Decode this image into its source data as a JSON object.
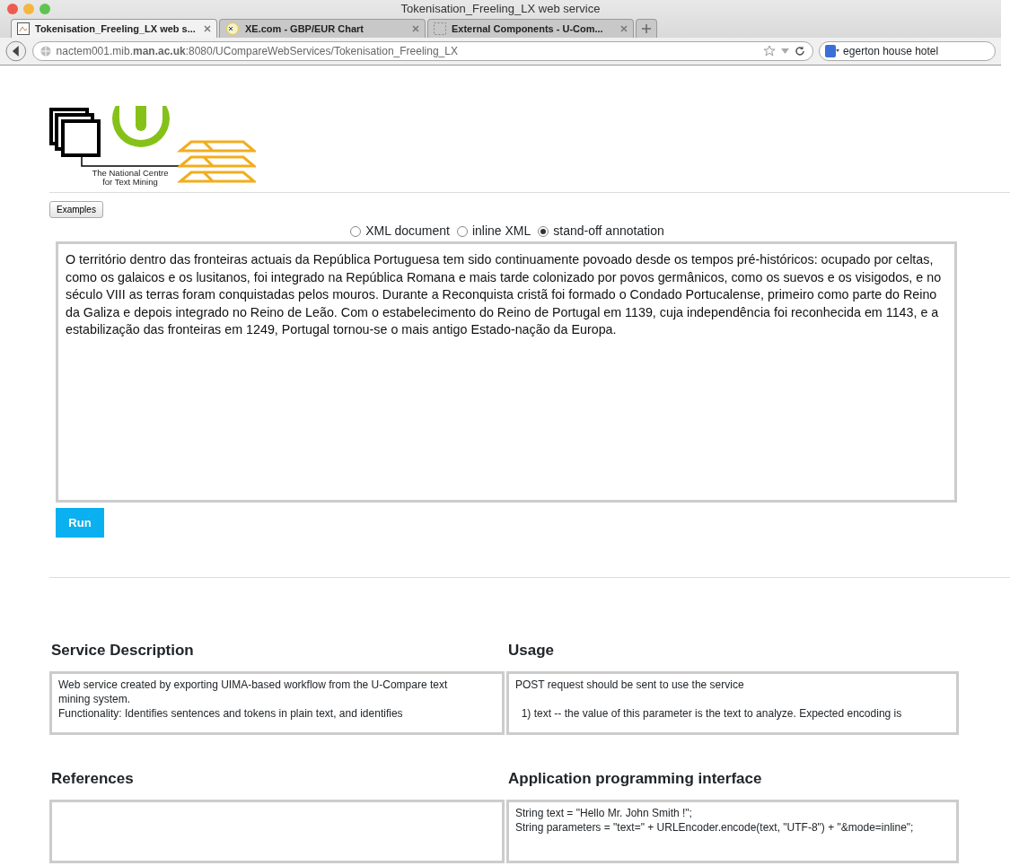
{
  "browser": {
    "window_title": "Tokenisation_Freeling_LX web service",
    "tabs": [
      {
        "label": "Tokenisation_Freeling_LX web s...",
        "selected": true
      },
      {
        "label": "XE.com - GBP/EUR Chart",
        "selected": false
      },
      {
        "label": "External Components - U-Com...",
        "selected": false
      }
    ],
    "address_bar": {
      "url": "nactem001.mib.**man.ac.uk**:8080/UCompareWebServices/Tokenisation_Freeling_LX"
    },
    "search_field": {
      "value": "egerton house hotel"
    }
  },
  "page": {
    "logo": {
      "caption_lines": [
        "The National Centre",
        "for Text Mining"
      ]
    },
    "examples_button": "Examples",
    "format_options": [
      {
        "label": "XML document",
        "selected": false
      },
      {
        "label": "inline XML",
        "selected": false
      },
      {
        "label": "stand-off annotation",
        "selected": true
      }
    ],
    "input_text": "O território dentro das fronteiras actuais da República Portuguesa tem sido continuamente povoado desde os tempos pré-históricos: ocupado por celtas, como os galaicos e os lusitanos, foi integrado na República Romana e mais tarde colonizado por povos germânicos, como os suevos e os visigodos, e no século VIII as terras foram conquistadas pelos mouros. Durante a Reconquista cristã foi formado o Condado Portucalense, primeiro como parte do Reino da Galiza e depois integrado no Reino de Leão. Com o estabelecimento do Reino de Portugal em 1139, cuja independência foi reconhecida em 1143, e a estabilização das fronteiras em 1249, Portugal tornou-se o mais antigo Estado-nação da Europa.",
    "run_button": "Run",
    "sections": [
      {
        "title": "Service Description",
        "paragraphs": [
          [
            "Web service created by exporting UIMA-based workflow from the U-Compare text mining system.",
            "Functionality: Identifies sentences and tokens in plain text, and identifies"
          ]
        ]
      },
      {
        "title": "Usage",
        "paragraphs": [
          [
            "POST request should be sent to use the service"
          ],
          [
            "  1) text -- the value of this parameter is the text to analyze. Expected encoding is"
          ]
        ]
      },
      {
        "title": "References"
      },
      {
        "title": "Application programming interface",
        "paragraphs": [
          [
            "String text = \"Hello Mr. John Smith !\";",
            "String parameters = \"text=\" + URLEncoder.encode(text, \"UTF-8\") + \"&mode=inline\";"
          ]
        ]
      }
    ]
  }
}
